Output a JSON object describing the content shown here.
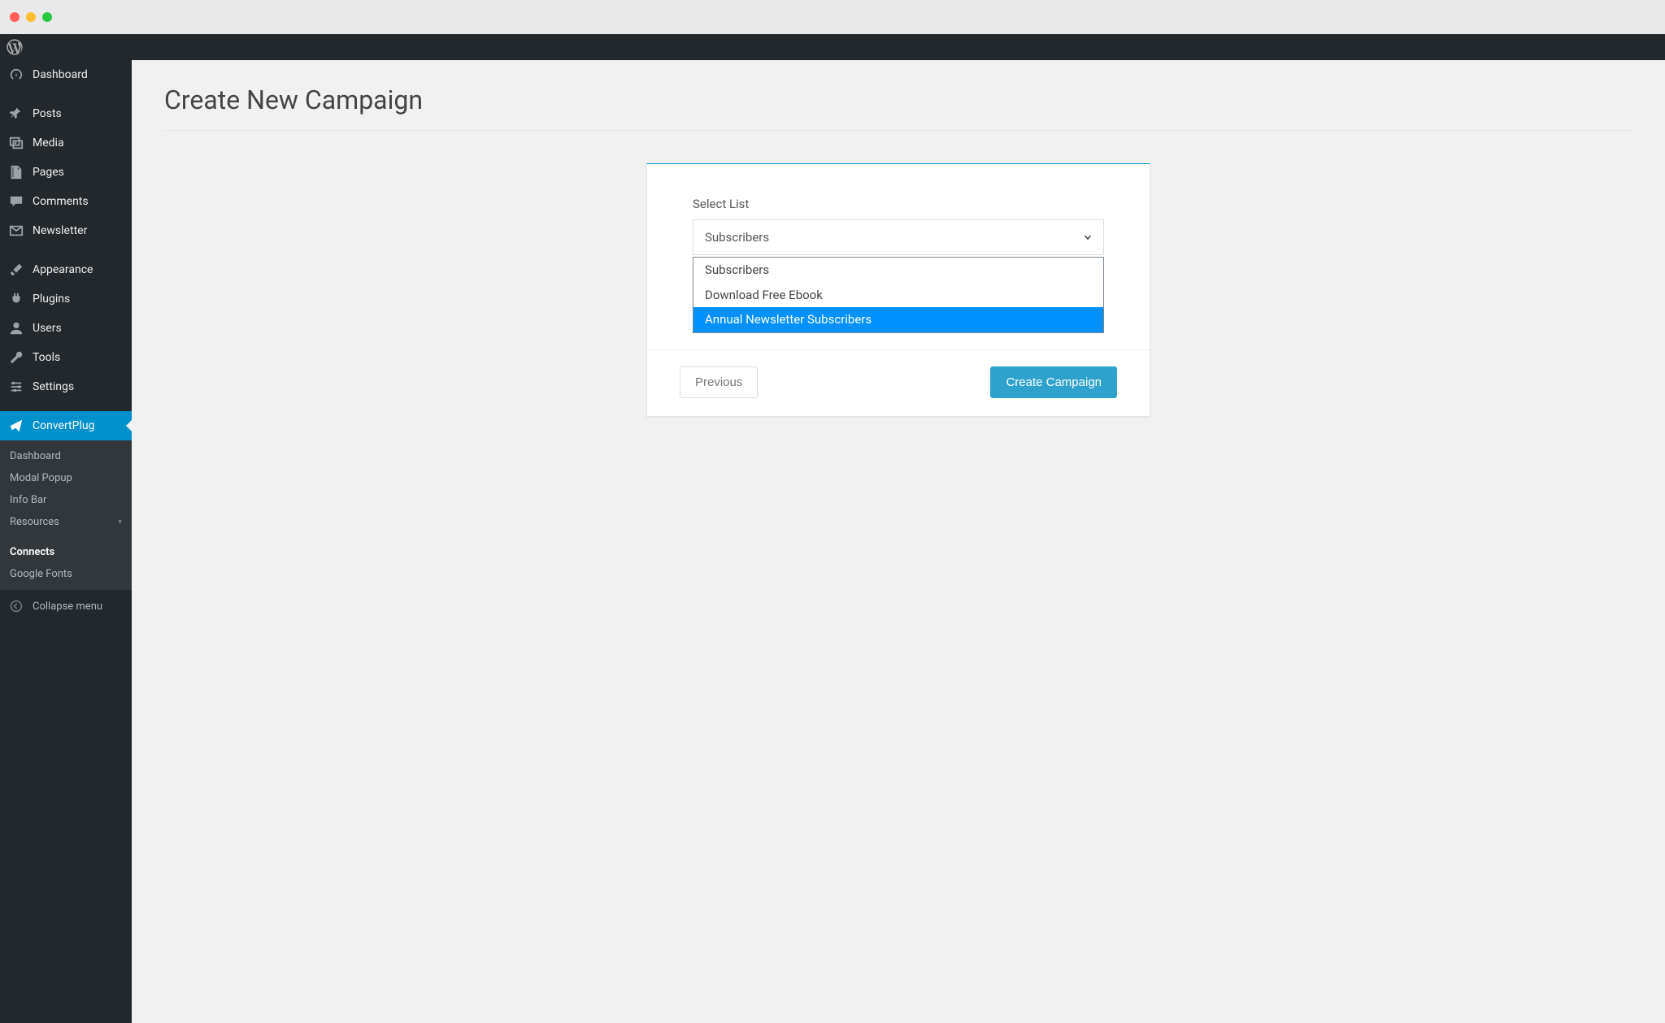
{
  "window": {
    "os": "mac"
  },
  "sidebar": {
    "groups": [
      [
        {
          "key": "dashboard",
          "icon": "dashboard",
          "label": "Dashboard"
        }
      ],
      [
        {
          "key": "posts",
          "icon": "pin",
          "label": "Posts"
        },
        {
          "key": "media",
          "icon": "media",
          "label": "Media"
        },
        {
          "key": "pages",
          "icon": "pages",
          "label": "Pages"
        },
        {
          "key": "comments",
          "icon": "comment",
          "label": "Comments"
        },
        {
          "key": "newsletter",
          "icon": "mail",
          "label": "Newsletter"
        }
      ],
      [
        {
          "key": "appearance",
          "icon": "brush",
          "label": "Appearance"
        },
        {
          "key": "plugins",
          "icon": "plug",
          "label": "Plugins"
        },
        {
          "key": "users",
          "icon": "user",
          "label": "Users"
        },
        {
          "key": "tools",
          "icon": "wrench",
          "label": "Tools"
        },
        {
          "key": "settings",
          "icon": "sliders",
          "label": "Settings"
        }
      ],
      [
        {
          "key": "convertplug",
          "icon": "paperplane",
          "label": "ConvertPlug",
          "active": true
        }
      ]
    ],
    "submenu": [
      {
        "label": "Dashboard",
        "current": false
      },
      {
        "label": "Modal Popup",
        "current": false
      },
      {
        "label": "Info Bar",
        "current": false
      },
      {
        "label": "Resources",
        "current": false,
        "caret": true
      },
      {
        "label": "Connects",
        "current": true
      },
      {
        "label": "Google Fonts",
        "current": false
      }
    ],
    "collapse_label": "Collapse menu"
  },
  "page": {
    "title": "Create New Campaign"
  },
  "form": {
    "select_list_label": "Select List",
    "select_list_value": "Subscribers",
    "options": [
      {
        "label": "Subscribers",
        "highlight": false
      },
      {
        "label": "Download Free Ebook",
        "highlight": false
      },
      {
        "label": "Annual Newsletter Subscribers",
        "highlight": true
      }
    ],
    "previous_label": "Previous",
    "create_label": "Create Campaign"
  },
  "colors": {
    "accent": "#0091cd",
    "highlight": "#0091ff"
  }
}
